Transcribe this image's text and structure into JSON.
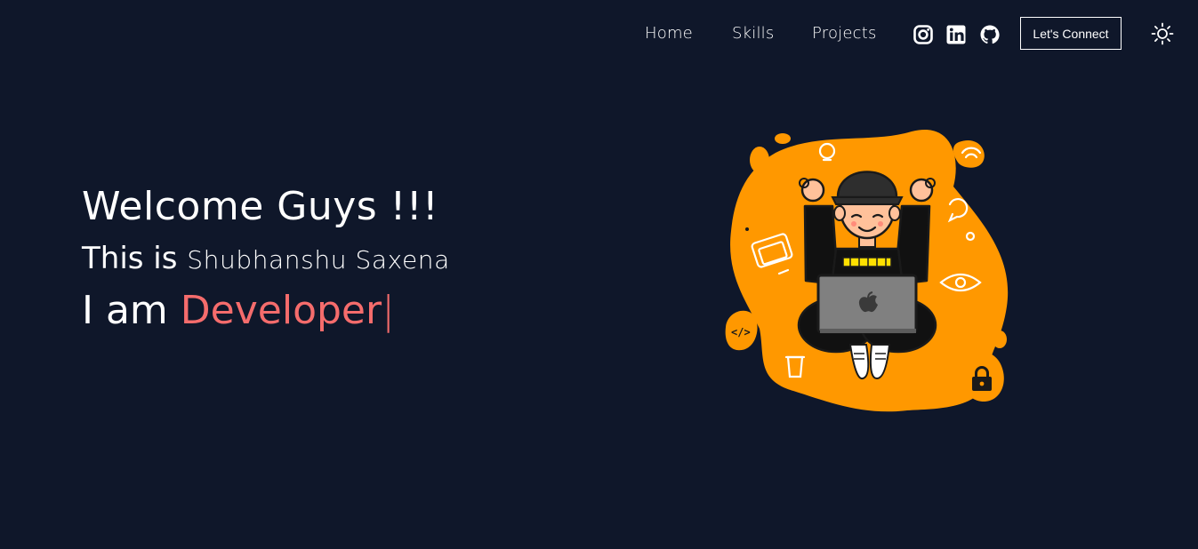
{
  "nav": {
    "links": [
      "Home",
      "Skills",
      "Projects"
    ],
    "connect_label": "Let's Connect"
  },
  "social": [
    "instagram-icon",
    "linkedin-icon",
    "github-icon"
  ],
  "theme_toggle_icon": "sun-icon",
  "hero": {
    "title": "Welcome Guys !!!",
    "intro_prefix": "This is ",
    "name": "Shubhanshu Saxena",
    "role_prefix": "I am ",
    "role_word": "Developer",
    "cursor": "|"
  },
  "colors": {
    "background": "#0f172a",
    "accent": "#f56c6c",
    "illustration_orange": "#ff9800"
  }
}
